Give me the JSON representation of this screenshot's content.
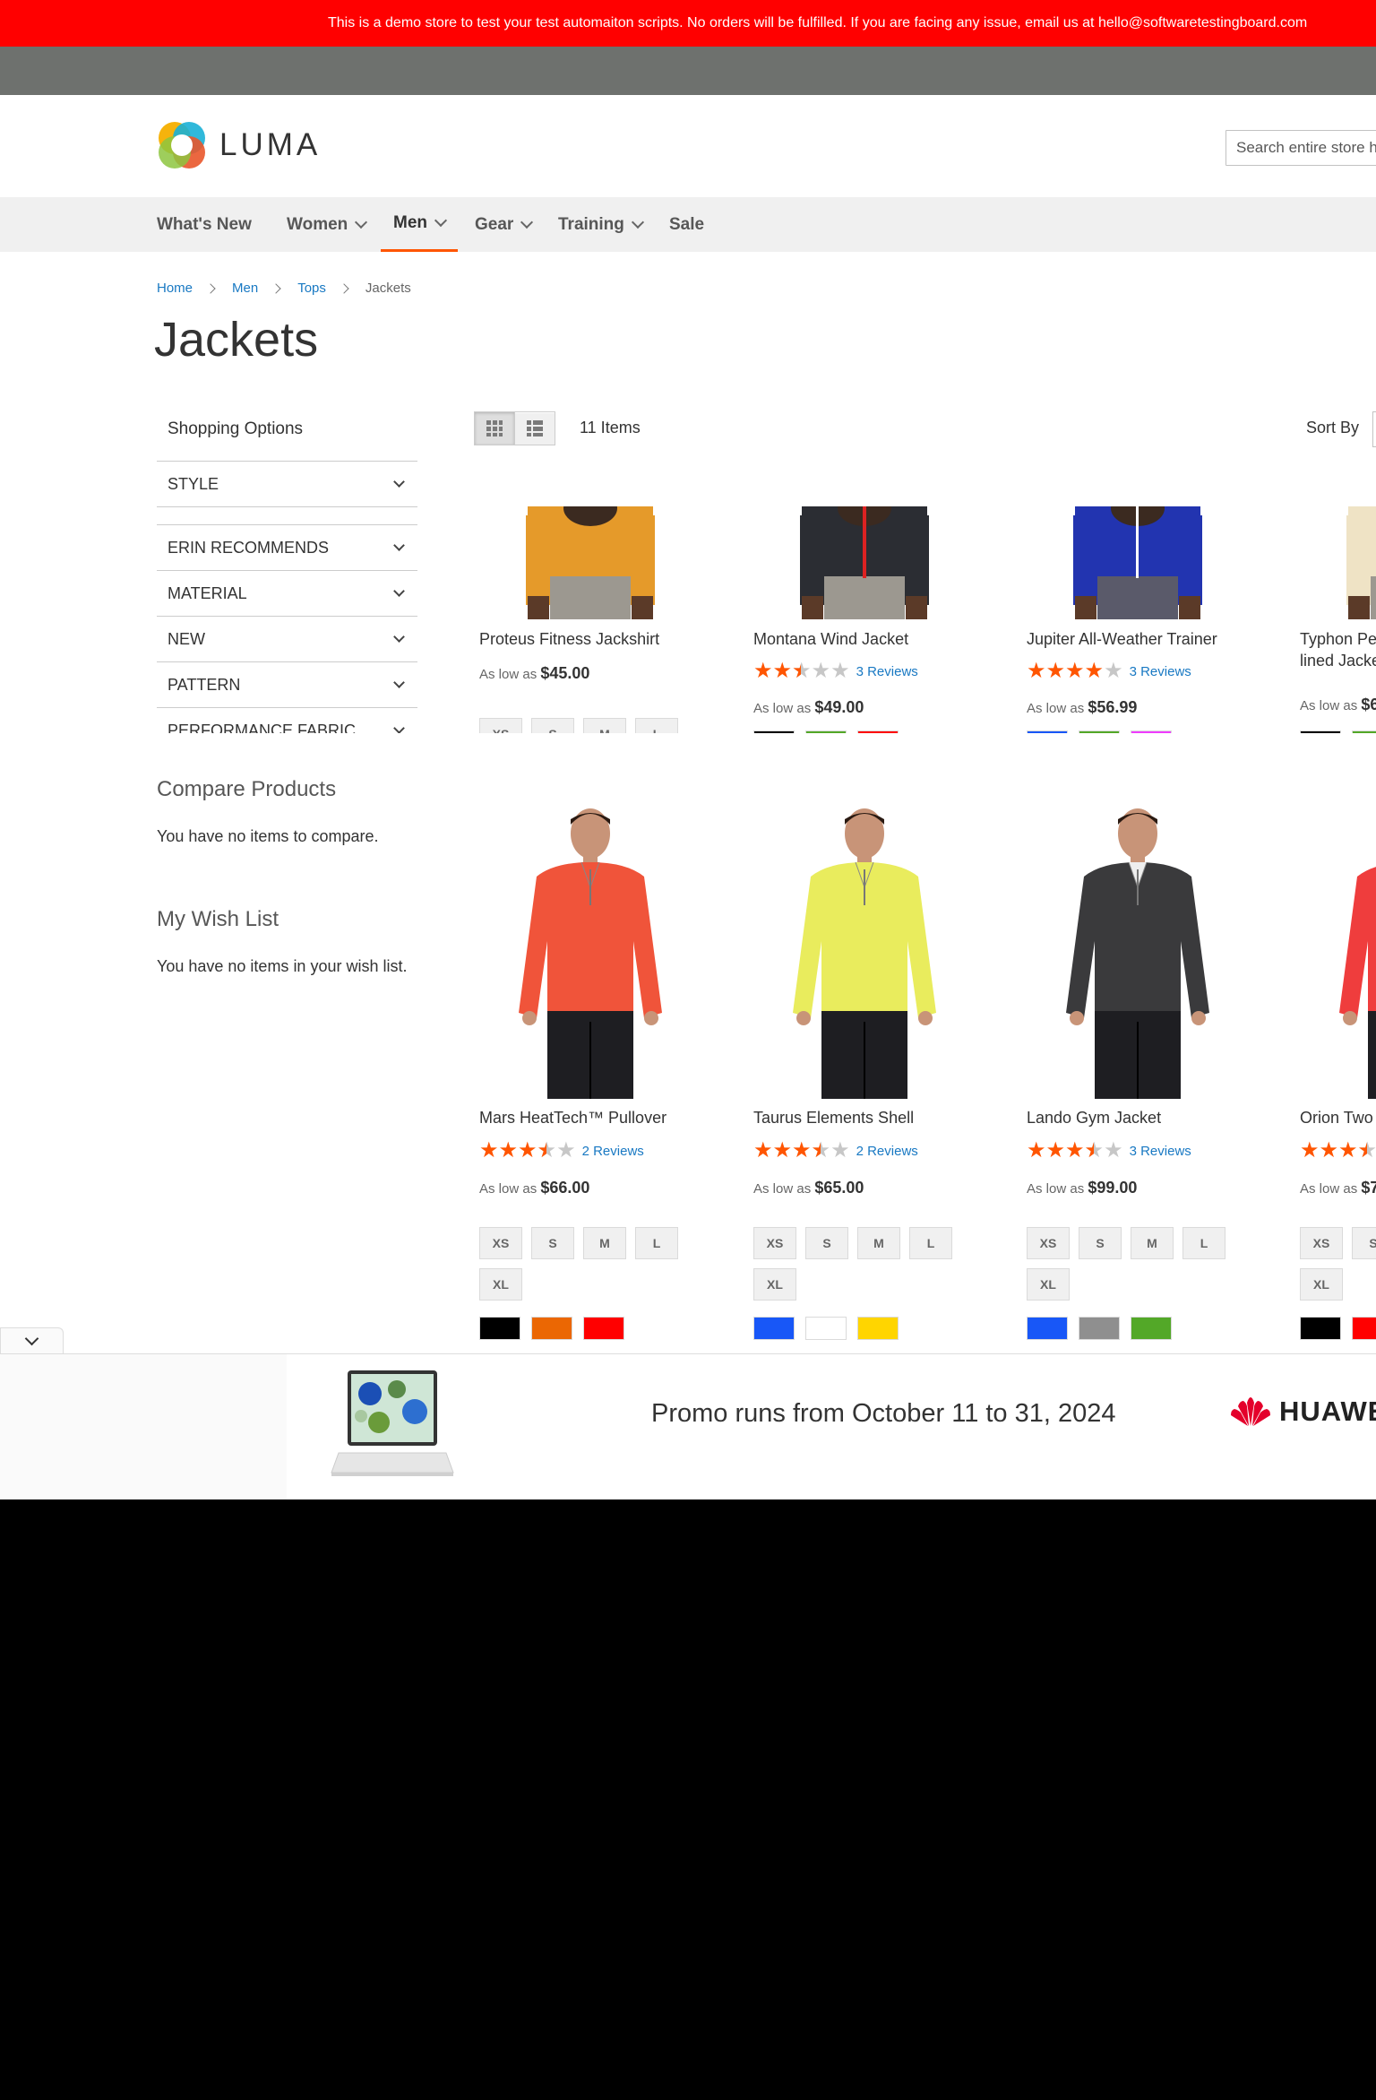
{
  "demo_notice": "This is a demo store to test your test automaiton scripts. No orders will be fulfilled. If you are facing any issue, email us at hello@softwaretestingboard.com",
  "logo_text": "LUMA",
  "search": {
    "placeholder": "Search entire store here..."
  },
  "nav": [
    {
      "label": "What's New"
    },
    {
      "label": "Women"
    },
    {
      "label": "Men"
    },
    {
      "label": "Gear"
    },
    {
      "label": "Training"
    },
    {
      "label": "Sale"
    }
  ],
  "breadcrumb": [
    "Home",
    "Men",
    "Tops",
    "Jackets"
  ],
  "page_title": "Jackets",
  "sidebar": {
    "shopping_options": "Shopping Options",
    "filters": [
      "STYLE",
      "ERIN RECOMMENDS",
      "MATERIAL",
      "NEW",
      "PATTERN",
      "PERFORMANCE FABRIC"
    ],
    "compare_title": "Compare Products",
    "compare_text": "You have no items to compare.",
    "wishlist_title": "My Wish List",
    "wishlist_text": "You have no items in your wish list."
  },
  "toolbar": {
    "items_count": "11 Items",
    "sort_label": "Sort By"
  },
  "price_prefix": "As low as",
  "products": [
    {
      "name": "Proteus Fitness Jackshirt",
      "price": "$45.00",
      "rating": null,
      "reviews": "",
      "sizes": [
        "XS",
        "S",
        "M",
        "L"
      ],
      "colors": []
    },
    {
      "name": "Montana Wind Jacket",
      "price": "$49.00",
      "rating": 2.5,
      "reviews": "3 Reviews",
      "sizes": [],
      "colors": [
        "#000000",
        "#53a828",
        "#ff0000"
      ]
    },
    {
      "name": "Jupiter All-Weather Trainer",
      "price": "$56.99",
      "rating": 4,
      "reviews": "3 Reviews",
      "sizes": [],
      "colors": [
        "#1857f7",
        "#53a828",
        "#ef3dff"
      ]
    },
    {
      "name": "Typhon Performance Fleece-lined Jacket",
      "name_line1": "Typhon Pe",
      "name_line2": "lined Jacke",
      "price": "$6",
      "rating": null,
      "reviews": "",
      "sizes": [],
      "colors": [
        "#000000",
        "#53a828"
      ]
    },
    {
      "name": "Mars HeatTech™ Pullover",
      "price": "$66.00",
      "rating": 3.5,
      "reviews": "2 Reviews",
      "sizes": [
        "XS",
        "S",
        "M",
        "L",
        "XL"
      ],
      "colors": [
        "#000000",
        "#eb6703",
        "#ff0000"
      ]
    },
    {
      "name": "Taurus Elements Shell",
      "price": "$65.00",
      "rating": 3.5,
      "reviews": "2 Reviews",
      "sizes": [
        "XS",
        "S",
        "M",
        "L",
        "XL"
      ],
      "colors": [
        "#1857f7",
        "#ffffff",
        "#ffd500"
      ]
    },
    {
      "name": "Lando Gym Jacket",
      "price": "$99.00",
      "rating": 3.5,
      "reviews": "3 Reviews",
      "sizes": [
        "XS",
        "S",
        "M",
        "L",
        "XL"
      ],
      "colors": [
        "#1857f7",
        "#8f8f8f",
        "#53a828"
      ]
    },
    {
      "name": "Orion Two",
      "price": "$7",
      "rating": 3.5,
      "reviews": "",
      "sizes": [
        "XS",
        "S",
        "XL"
      ],
      "colors": [
        "#000000",
        "#ff0000"
      ]
    }
  ],
  "ad": {
    "text": "Promo runs from October 11 to 31, 2024",
    "brand": "HUAWE"
  },
  "colors": {
    "demo_bar": "#ff0000",
    "accent": "#ff5501",
    "link": "#1979c3"
  }
}
